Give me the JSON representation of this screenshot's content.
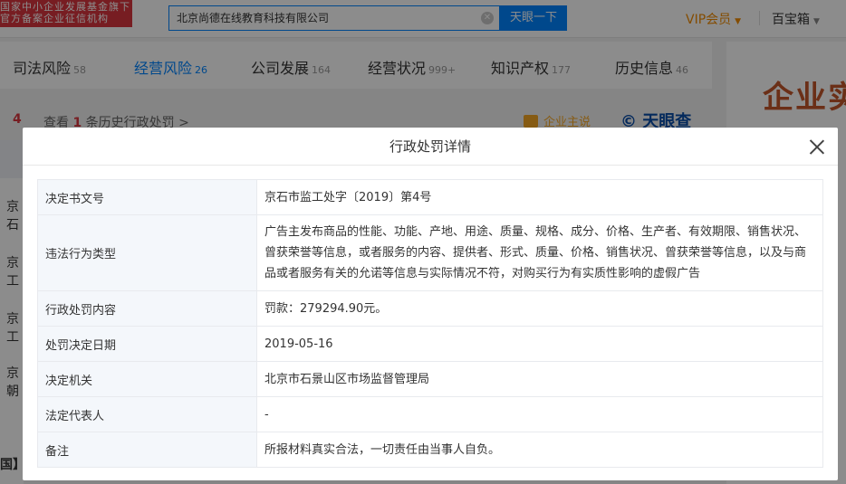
{
  "header": {
    "brand_line1": "国家中小企业发展基金旗下",
    "brand_line2": "官方备案企业征信机构",
    "search_value": "北京尚德在线教育科技有限公司",
    "search_button": "天眼一下",
    "vip_label": "VIP会员",
    "toolbox_label": "百宝箱"
  },
  "nav": {
    "tabs": [
      {
        "label": "司法风险",
        "count": "58"
      },
      {
        "label": "经营风险",
        "count": "26"
      },
      {
        "label": "公司发展",
        "count": "164"
      },
      {
        "label": "经营状况",
        "count": "999+"
      },
      {
        "label": "知识产权",
        "count": "177"
      },
      {
        "label": "历史信息",
        "count": "46"
      }
    ]
  },
  "subrow": {
    "count": "4",
    "history_prefix": "查看",
    "history_num": "1",
    "history_suffix": "条历史行政处罚 >",
    "biz_say": "企业主说",
    "logo_text": "天眼查"
  },
  "background_rows": [
    "京石",
    "京工",
    "京工",
    "京朝"
  ],
  "background_bottom": "国】",
  "right_ad": {
    "title": "企业实"
  },
  "modal": {
    "title": "行政处罚详情",
    "rows": [
      {
        "key": "决定书文号",
        "value": "京石市监工处字〔2019〕第4号"
      },
      {
        "key": "违法行为类型",
        "value": "广告主发布商品的性能、功能、产地、用途、质量、规格、成分、价格、生产者、有效期限、销售状况、曾获荣誉等信息，或者服务的内容、提供者、形式、质量、价格、销售状况、曾获荣誉等信息，以及与商品或者服务有关的允诺等信息与实际情况不符，对购买行为有实质性影响的虚假广告"
      },
      {
        "key": "行政处罚内容",
        "value": "罚款：279294.90元。"
      },
      {
        "key": "处罚决定日期",
        "value": "2019-05-16"
      },
      {
        "key": "决定机关",
        "value": "北京市石景山区市场监督管理局"
      },
      {
        "key": "法定代表人",
        "value": "-"
      },
      {
        "key": "备注",
        "value": "所报材料真实合法，一切责任由当事人自负。"
      }
    ]
  }
}
